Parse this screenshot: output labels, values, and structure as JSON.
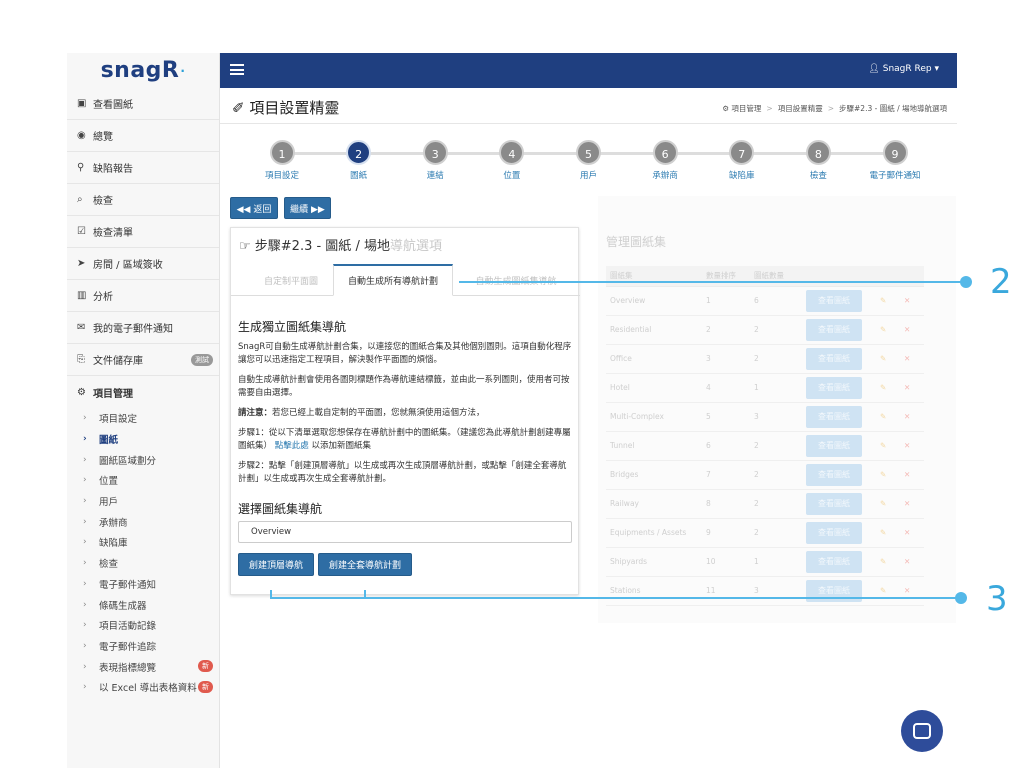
{
  "brand": {
    "logo": "snagR",
    "logo_mark": "·"
  },
  "topbar": {
    "user": "SnagR Rep ▾"
  },
  "sidebar": {
    "items": [
      {
        "icon": "▣",
        "label": "查看圖紙"
      },
      {
        "icon": "◉",
        "label": "總覽"
      },
      {
        "icon": "⚲",
        "label": "缺陷報告"
      },
      {
        "icon": "⌕",
        "label": "檢查"
      },
      {
        "icon": "☑",
        "label": "檢查清單"
      },
      {
        "icon": "➤",
        "label": "房間 / 區域簽收"
      },
      {
        "icon": "▥",
        "label": "分析"
      },
      {
        "icon": "✉",
        "label": "我的電子郵件通知"
      },
      {
        "icon": "⎘",
        "label": "文件儲存庫",
        "badge": "測試"
      }
    ],
    "section": {
      "icon": "⚙",
      "label": "項目管理"
    },
    "subitems": [
      {
        "label": "項目設定"
      },
      {
        "label": "圖紙",
        "active": true
      },
      {
        "label": "圖紙區域劃分"
      },
      {
        "label": "位置"
      },
      {
        "label": "用戶"
      },
      {
        "label": "承辦商"
      },
      {
        "label": "缺陷庫"
      },
      {
        "label": "檢查"
      },
      {
        "label": "電子郵件通知"
      },
      {
        "label": "條碼生成器"
      },
      {
        "label": "項目活動記錄"
      },
      {
        "label": "電子郵件追踪"
      },
      {
        "label": "表現指標總覽",
        "badge": "新"
      },
      {
        "label": "以 Excel 導出表格資料",
        "badge": "新"
      }
    ]
  },
  "header": {
    "title": "✐ 項目設置精靈",
    "breadcrumb": [
      "⚙ 項目管理",
      "項目設置精靈",
      "步驟#2.3 - 圖紙 / 場地導航選項"
    ]
  },
  "stepper": {
    "steps": [
      {
        "num": "1",
        "label": "項目設定"
      },
      {
        "num": "2",
        "label": "圖紙",
        "active": true
      },
      {
        "num": "3",
        "label": "連結"
      },
      {
        "num": "4",
        "label": "位置"
      },
      {
        "num": "5",
        "label": "用戶"
      },
      {
        "num": "6",
        "label": "承辦商"
      },
      {
        "num": "7",
        "label": "缺陷庫"
      },
      {
        "num": "8",
        "label": "檢查"
      },
      {
        "num": "9",
        "label": "電子郵件通知"
      }
    ]
  },
  "actions": {
    "back": "◀◀ 返回",
    "next": "繼續 ▶▶"
  },
  "panel": {
    "title_main": "☞ 步驟#2.3 - 圖紙 / 場地",
    "title_faded": "導航選項",
    "tabs": [
      {
        "label": "自定制平面圖",
        "faded": true
      },
      {
        "label": "自動生成所有導航計劃",
        "active": true
      },
      {
        "label": "自動生成圖紙集導航",
        "faded": true
      }
    ],
    "heading": "生成獨立圖紙集導航",
    "p1": "SnagR可自動生成導航計劃合集，以連接您的圖紙合集及其他個別圖則。這項自動化程序讓您可以迅速指定工程項目，解決製作平面圖的煩惱。",
    "p2": "自動生成導航計劃會使用各圖則標題作為導航連結標籤，並由此一系列圖則，使用者可按需要自由選擇。",
    "note_label": "請注意：",
    "note_text": "若您已經上載自定制的平面圖，您就無須使用這個方法，",
    "p4_pre": "步驟1：從以下清單選取您想保存在導航計劃中的圖紙集。（建議您為此導航計劃創建專屬圖紙集）",
    "p4_link": "點擊此處",
    "p4_post": "以添加新圖紙集",
    "p5": "步驟2：點擊「創建頂層導航」以生成或再次生成頂層導航計劃，或點擊「創建全套導航計劃」以生成或再次生成全套導航計劃。",
    "select_heading": "選擇圖紙集導航",
    "select_value": "Overview",
    "btn_top": "創建頂層導航",
    "btn_full": "創建全套導航計劃"
  },
  "drawing_sets": {
    "title": "管理圖紙集",
    "columns": [
      "圖紙集",
      "數量排序",
      "圖紙數量",
      "",
      "",
      ""
    ],
    "view_label": "查看圖紙",
    "rows": [
      {
        "name": "Overview",
        "order": "1",
        "count": "6"
      },
      {
        "name": "Residential",
        "order": "2",
        "count": "2"
      },
      {
        "name": "Office",
        "order": "3",
        "count": "2"
      },
      {
        "name": "Hotel",
        "order": "4",
        "count": "1"
      },
      {
        "name": "Multi-Complex",
        "order": "5",
        "count": "3"
      },
      {
        "name": "Tunnel",
        "order": "6",
        "count": "2"
      },
      {
        "name": "Bridges",
        "order": "7",
        "count": "2"
      },
      {
        "name": "Railway",
        "order": "8",
        "count": "2"
      },
      {
        "name": "Equipments / Assets",
        "order": "9",
        "count": "2"
      },
      {
        "name": "Shipyards",
        "order": "10",
        "count": "1"
      },
      {
        "name": "Stations",
        "order": "11",
        "count": "3"
      }
    ]
  },
  "callouts": {
    "c2": "2",
    "c3": "3"
  }
}
